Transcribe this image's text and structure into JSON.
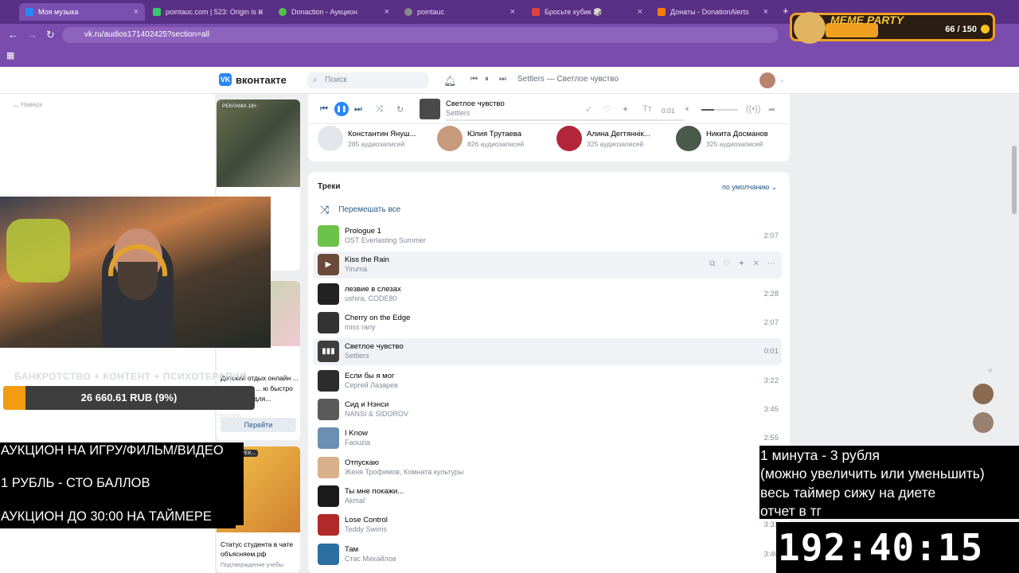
{
  "browser": {
    "tabs": [
      {
        "title": "Моя музыка",
        "active": true
      },
      {
        "title": "pointauc.com | 523: Origin is u"
      },
      {
        "title": "Donaction - Аукцион"
      },
      {
        "title": "pointauc"
      },
      {
        "title": "Бросьте кубик 🎲"
      },
      {
        "title": "Донаты - DonationAlerts"
      }
    ],
    "url": "vk.ru/audios171402425?section=all"
  },
  "vk": {
    "logo": "вконтакте",
    "search_placeholder": "Поиск",
    "header_track": "Settlers — Светлое чувство",
    "back_to_top": "Наверх",
    "player": {
      "title": "Светлое чувство",
      "artist": "Settlers",
      "time": "0:01",
      "volume": 0.35
    },
    "friends": [
      {
        "name": "Константин Януш...",
        "sub": "285 аудиозаписей"
      },
      {
        "name": "Юлия Трутаева",
        "sub": "826 аудиозаписей"
      },
      {
        "name": "Алина Дегтяннік...",
        "sub": "325 аудиозаписей"
      },
      {
        "name": "Никита Досманов",
        "sub": "325 аудиозаписей"
      }
    ],
    "tracks_title": "Треки",
    "sort_label": "по умолчанию",
    "shuffle_label": "Перемешать все",
    "tracks": [
      {
        "title": "Prologue 1",
        "artist": "OST Everlasting Summer",
        "duration": "2:07",
        "color": "#6cc24a"
      },
      {
        "title": "Kiss the Rain",
        "artist": "Yiruma",
        "duration": "",
        "color": "#6b4a3a"
      },
      {
        "title": "лезвие в слезах",
        "artist": "ushira, CODE80",
        "duration": "2:28",
        "color": "#222"
      },
      {
        "title": "Cherry on the Edge",
        "artist": "miss rany",
        "duration": "2:07",
        "color": "#333"
      },
      {
        "title": "Светлое чувство",
        "artist": "Settlers",
        "duration": "0:01",
        "color": "#3d3d3d"
      },
      {
        "title": "Если бы я мог",
        "artist": "Сергей Лазарев",
        "duration": "3:22",
        "color": "#2c2c2c"
      },
      {
        "title": "Сид и Нэнси",
        "artist": "NANSI & SIDOROV",
        "duration": "3:45",
        "color": "#5a5a5a"
      },
      {
        "title": "I Know",
        "artist": "Faouzia",
        "duration": "2:55",
        "color": "#6a8fb3"
      },
      {
        "title": "Отпускаю",
        "artist": "Женя Трофимов, Комната культуры",
        "duration": "",
        "color": "#d9b08c"
      },
      {
        "title": "Ты мне покажи...",
        "artist": "Akmal'",
        "duration": "",
        "color": "#1a1a1a"
      },
      {
        "title": "Lose Control",
        "artist": "Teddy Swims",
        "duration": "3:31",
        "color": "#b02a2a"
      },
      {
        "title": "Там",
        "artist": "Стас Михайлов",
        "duration": "3:40",
        "color": "#2a6fa0"
      }
    ],
    "ads": {
      "label1": "РЕКЛАМА 18+",
      "text2": "Детский отдых онлайн ... ньпроекты ... ю быстро ... путевку для...",
      "button2": "Перейти",
      "label3": "ЛЬНАЯ РЕК...",
      "title3": "Статус студента в чате объясняем.рф",
      "sub3": "Подтверждение учебы"
    }
  },
  "stream": {
    "bankruptcy_label": "БАНКРОТСТВО + КОНТЕНТ + ПСИХОТЕРАПИЯ",
    "donation_text": "26 660.61 RUB (9%)",
    "donation_progress": 0.09,
    "donation_min": "0",
    "donation_max": "300 000",
    "auction_lines": [
      "АУКЦИОН НА ИГРУ/ФИЛЬМ/ВИДЕО",
      "1 РУБЛЬ - СТО БАЛЛОВ",
      "АУКЦИОН ДО 30:00 НА ТАЙМЕРЕ"
    ],
    "info_lines": [
      "1 минута - 3 рубля",
      "(можно увеличить или уменьшить)",
      "весь таймер сижу на диете",
      "отчет в тг"
    ],
    "timer": "192:40:15",
    "meme_title": "MEME PARTY",
    "meme_count": "66 / 150"
  }
}
